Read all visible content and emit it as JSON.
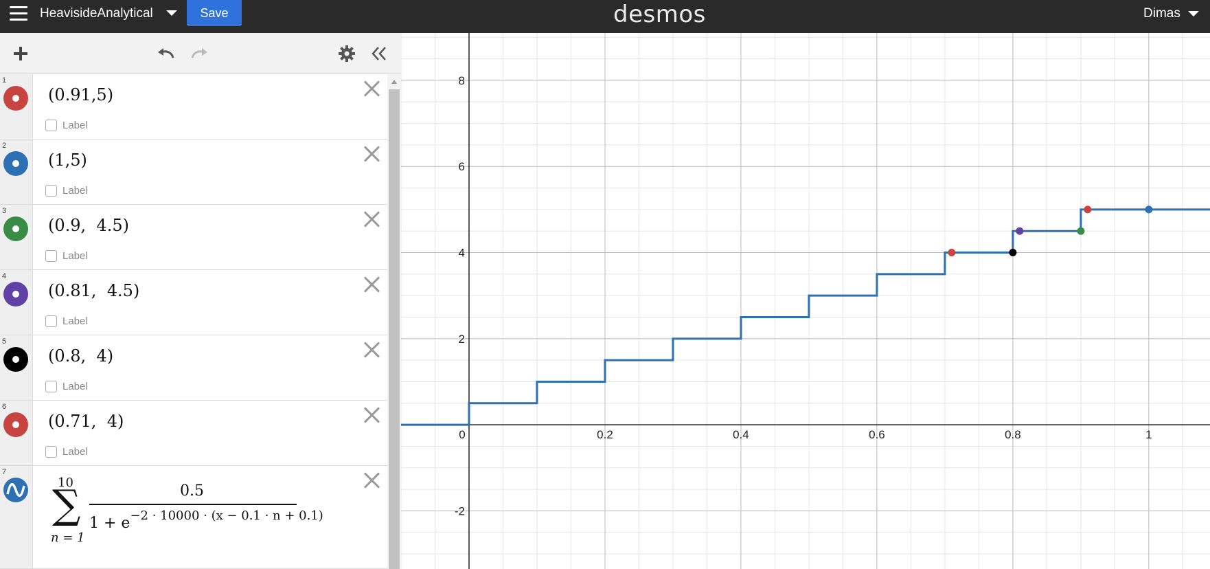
{
  "header": {
    "graph_title": "HeavisideAnalytical",
    "save_label": "Save",
    "brand": "desmos",
    "user_name": "Dimas"
  },
  "toolbar": {
    "add_icon": "plus-icon",
    "undo_icon": "undo-icon",
    "redo_icon": "redo-icon",
    "settings_icon": "gear-icon",
    "collapse_icon": "double-chevron-left-icon"
  },
  "expressions": [
    {
      "index": "1",
      "latex": "(0.91,5)",
      "color": "#c74440",
      "label": "Label"
    },
    {
      "index": "2",
      "latex": "(1,5)",
      "color": "#2d70b3",
      "label": "Label"
    },
    {
      "index": "3",
      "latex": "(0.9,  4.5)",
      "color": "#388c46",
      "label": "Label"
    },
    {
      "index": "4",
      "latex": "(0.81,  4.5)",
      "color": "#6042a6",
      "label": "Label"
    },
    {
      "index": "5",
      "latex": "(0.8,  4)",
      "color": "#000000",
      "label": "Label"
    },
    {
      "index": "6",
      "latex": "(0.71,  4)",
      "color": "#c74440",
      "label": "Label"
    },
    {
      "index": "7",
      "color": "#2d70b3",
      "sum_upper": "10",
      "sum_lower": "n = 1",
      "numerator": "0.5",
      "denominator_base": "1 + e",
      "denominator_exponent": "−2 · 10000 · (x − 0.1 · n + 0.1)"
    }
  ],
  "graph": {
    "x_ticks": [
      "0",
      "0.2",
      "0.4",
      "0.6",
      "0.8",
      "1"
    ],
    "y_ticks": [
      "8",
      "6",
      "4",
      "2",
      "-2"
    ],
    "curve_color": "#2d70b3",
    "grid": true
  },
  "chart_data": {
    "type": "line",
    "xlim": [
      -0.1,
      1.09
    ],
    "ylim": [
      -3.35,
      9.1
    ],
    "x_tick_values": [
      0,
      0.2,
      0.4,
      0.6,
      0.8,
      1
    ],
    "y_tick_values": [
      8,
      6,
      4,
      2,
      -2
    ],
    "grid": true,
    "series": [
      {
        "color": "#2d70b3",
        "x": [
          -0.1,
          0,
          0.1,
          0.2,
          0.3,
          0.4,
          0.5,
          0.6,
          0.7,
          0.8,
          0.9,
          1.09
        ],
        "y": [
          0,
          0.5,
          1,
          1.5,
          2,
          2.5,
          3,
          3.5,
          4,
          4.5,
          5,
          5
        ],
        "shape": "step"
      }
    ],
    "points": [
      {
        "x": 0.91,
        "y": 5,
        "color": "#c74440"
      },
      {
        "x": 1,
        "y": 5,
        "color": "#2d70b3"
      },
      {
        "x": 0.9,
        "y": 4.5,
        "color": "#388c46"
      },
      {
        "x": 0.81,
        "y": 4.5,
        "color": "#6042a6"
      },
      {
        "x": 0.8,
        "y": 4,
        "color": "#000000"
      },
      {
        "x": 0.71,
        "y": 4,
        "color": "#c74440"
      }
    ]
  }
}
